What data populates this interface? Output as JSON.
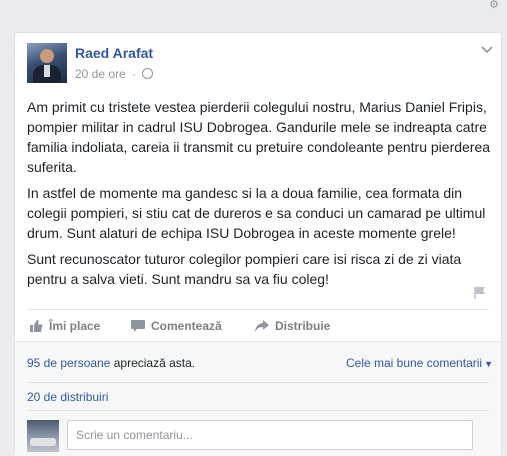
{
  "post": {
    "author": "Raed Arafat",
    "time": "20 de ore",
    "separator": "·",
    "paragraphs": [
      "Am primit cu tristete vestea pierderii colegului nostru, Marius Daniel Fripis, pompier militar in cadrul ISU Dobrogea. Gandurile mele se indreapta catre familia indoliata, careia ii transmit cu pretuire condoleante pentru pierderea suferita.",
      "In astfel de momente ma gandesc si la a doua familie, cea formata din colegii pompieri, si stiu cat de dureros e sa conduci un camarad pe ultimul drum. Sunt alaturi de echipa ISU Dobrogea in aceste momente grele!",
      "Sunt recunoscator tuturor colegilor pompieri care isi risca zi de zi viata pentru a salva vieti. Sunt mandru sa va fiu coleg!"
    ]
  },
  "actions": {
    "like": "Îmi place",
    "comment": "Comentează",
    "share": "Distribuie"
  },
  "stats": {
    "likes_link": "95 de persoane",
    "likes_text": " apreciază asta.",
    "best_comments": "Cele mai bune comentarii",
    "shares": "20 de distribuiri"
  },
  "comment_box": {
    "placeholder": "Scrie un comentariu..."
  },
  "icons": {
    "privacy": "globe-icon",
    "menu": "chevron-down-icon",
    "report": "flag-icon",
    "like": "thumbs-up-icon",
    "comment": "speech-bubble-icon",
    "share": "share-arrow-icon"
  },
  "colors": {
    "link": "#365899",
    "meta": "#90949c",
    "background": "#e9ebee"
  }
}
